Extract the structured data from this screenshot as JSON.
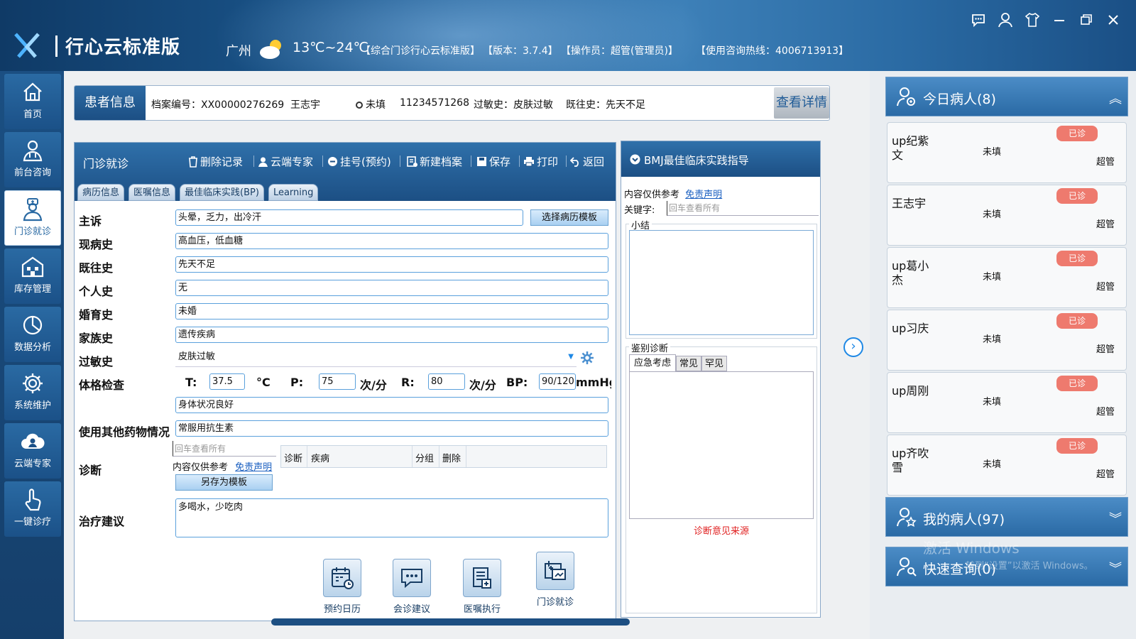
{
  "header": {
    "app_title": "行心云标准版",
    "city": "广州",
    "temperature": "13℃~24℃",
    "edition": "【综合门诊行心云标准版】",
    "version": "【版本：3.7.4】",
    "operator": "【操作员：超管(管理员)】",
    "hotline": "【使用咨询热线：4006713913】",
    "icons": [
      "chat-icon",
      "user-icon",
      "skin-icon",
      "minimize-icon",
      "restore-icon",
      "close-icon"
    ]
  },
  "nav": {
    "items": [
      {
        "label": "首页",
        "icon": "home-icon"
      },
      {
        "label": "前台咨询",
        "icon": "doctor-icon"
      },
      {
        "label": "门诊就诊",
        "icon": "nurse-icon",
        "active": true
      },
      {
        "label": "库存管理",
        "icon": "warehouse-icon"
      },
      {
        "label": "数据分析",
        "icon": "chart-icon"
      },
      {
        "label": "系统维护",
        "icon": "gear-icon"
      },
      {
        "label": "云端专家",
        "icon": "cloud-expert-icon"
      },
      {
        "label": "一键诊疗",
        "icon": "touch-icon"
      }
    ]
  },
  "patient": {
    "tag": "患者信息",
    "file_no": "档案编号：XX00000276269",
    "name": "王志宇",
    "gender": "未填",
    "phone": "11234571268",
    "allergy": "过敏史：皮肤过敏",
    "history": "既往史：先天不足",
    "detail_btn": "查看详情"
  },
  "visit": {
    "title": "门诊就诊",
    "toolbar": {
      "delete": "删除记录",
      "cloud": "云端专家",
      "register": "挂号(预约)",
      "new_file": "新建档案",
      "save": "保存",
      "print": "打印",
      "back": "返回"
    },
    "tabs": [
      "病历信息",
      "医嘱信息",
      "最佳临床实践(BP)",
      "Learning"
    ],
    "fields": {
      "chief_label": "主诉",
      "chief_value": "头晕，乏力，出冷汗",
      "template_btn": "选择病历模板",
      "present_label": "现病史",
      "present_value": "高血压，低血糖",
      "past_label": "既往史",
      "past_value": "先天不足",
      "personal_label": "个人史",
      "personal_value": "无",
      "marital_label": "婚育史",
      "marital_value": "未婚",
      "family_label": "家族史",
      "family_value": "遗传疾病",
      "allergy_label": "过敏史",
      "allergy_value": "皮肤过敏",
      "exam_label": "体格检查",
      "t_label": "T:",
      "t_value": "37.5",
      "t_unit": "°C",
      "p_label": "P:",
      "p_value": "75",
      "p_unit": "次/分",
      "r_label": "R:",
      "r_value": "80",
      "r_unit": "次/分",
      "bp_label": "BP:",
      "bp_value": "90/120",
      "bp_unit": "mmHg",
      "exam_value": "身体状况良好",
      "other_drug_label": "使用其他药物情况",
      "other_drug_value": "常服用抗生素",
      "diag_label": "诊断",
      "diag_placeholder": "回车查看所有",
      "ref_text": "内容仅供参考",
      "disclaimer": "免责声明",
      "save_template": "另存为模板",
      "grid_cols": [
        "诊断",
        "疾病",
        "分组",
        "删除"
      ],
      "advice_label": "治疗建议",
      "advice_value": "多喝水，少吃肉"
    }
  },
  "bmj": {
    "title": "BMJ最佳临床实践指导",
    "ref_text": "内容仅供参考",
    "disclaimer": "免责声明",
    "keyword_label": "关键字:",
    "keyword_placeholder": "回车查看所有",
    "summary_label": "小结",
    "diff_label": "鉴别诊断",
    "diff_tabs": [
      "应急考虑",
      "常见",
      "罕见"
    ],
    "source_link": "诊断意见来源"
  },
  "right": {
    "today_title": "今日病人(8)",
    "patients": [
      {
        "name": "up纪紫文",
        "status": "未填",
        "doctor": "超管",
        "badge": "已诊"
      },
      {
        "name": "王志宇",
        "status": "未填",
        "doctor": "超管",
        "badge": "已诊"
      },
      {
        "name": "up葛小杰",
        "status": "未填",
        "doctor": "超管",
        "badge": "已诊"
      },
      {
        "name": "up习庆",
        "status": "未填",
        "doctor": "超管",
        "badge": "已诊"
      },
      {
        "name": "up周刚",
        "status": "未填",
        "doctor": "超管",
        "badge": "已诊"
      },
      {
        "name": "up齐吹雪",
        "status": "未填",
        "doctor": "超管",
        "badge": "已诊"
      }
    ],
    "my_patients_title": "我的病人(97)",
    "quick_query_title": "快速查询(0)"
  },
  "shortcuts": [
    {
      "label": "预约日历",
      "icon": "calendar-icon"
    },
    {
      "label": "会诊建议",
      "icon": "consult-icon"
    },
    {
      "label": "医嘱执行",
      "icon": "order-icon"
    },
    {
      "label": "门诊就诊",
      "icon": "visit-icon"
    }
  ],
  "watermark": {
    "line1": "激活 Windows",
    "line2": "转到“设置”以激活 Windows。"
  },
  "colors": {
    "header_blue": "#1d5b93",
    "accent_blue": "#2a6aa3",
    "badge_red": "#ee7a6e",
    "link_blue": "#1a5fc0"
  }
}
